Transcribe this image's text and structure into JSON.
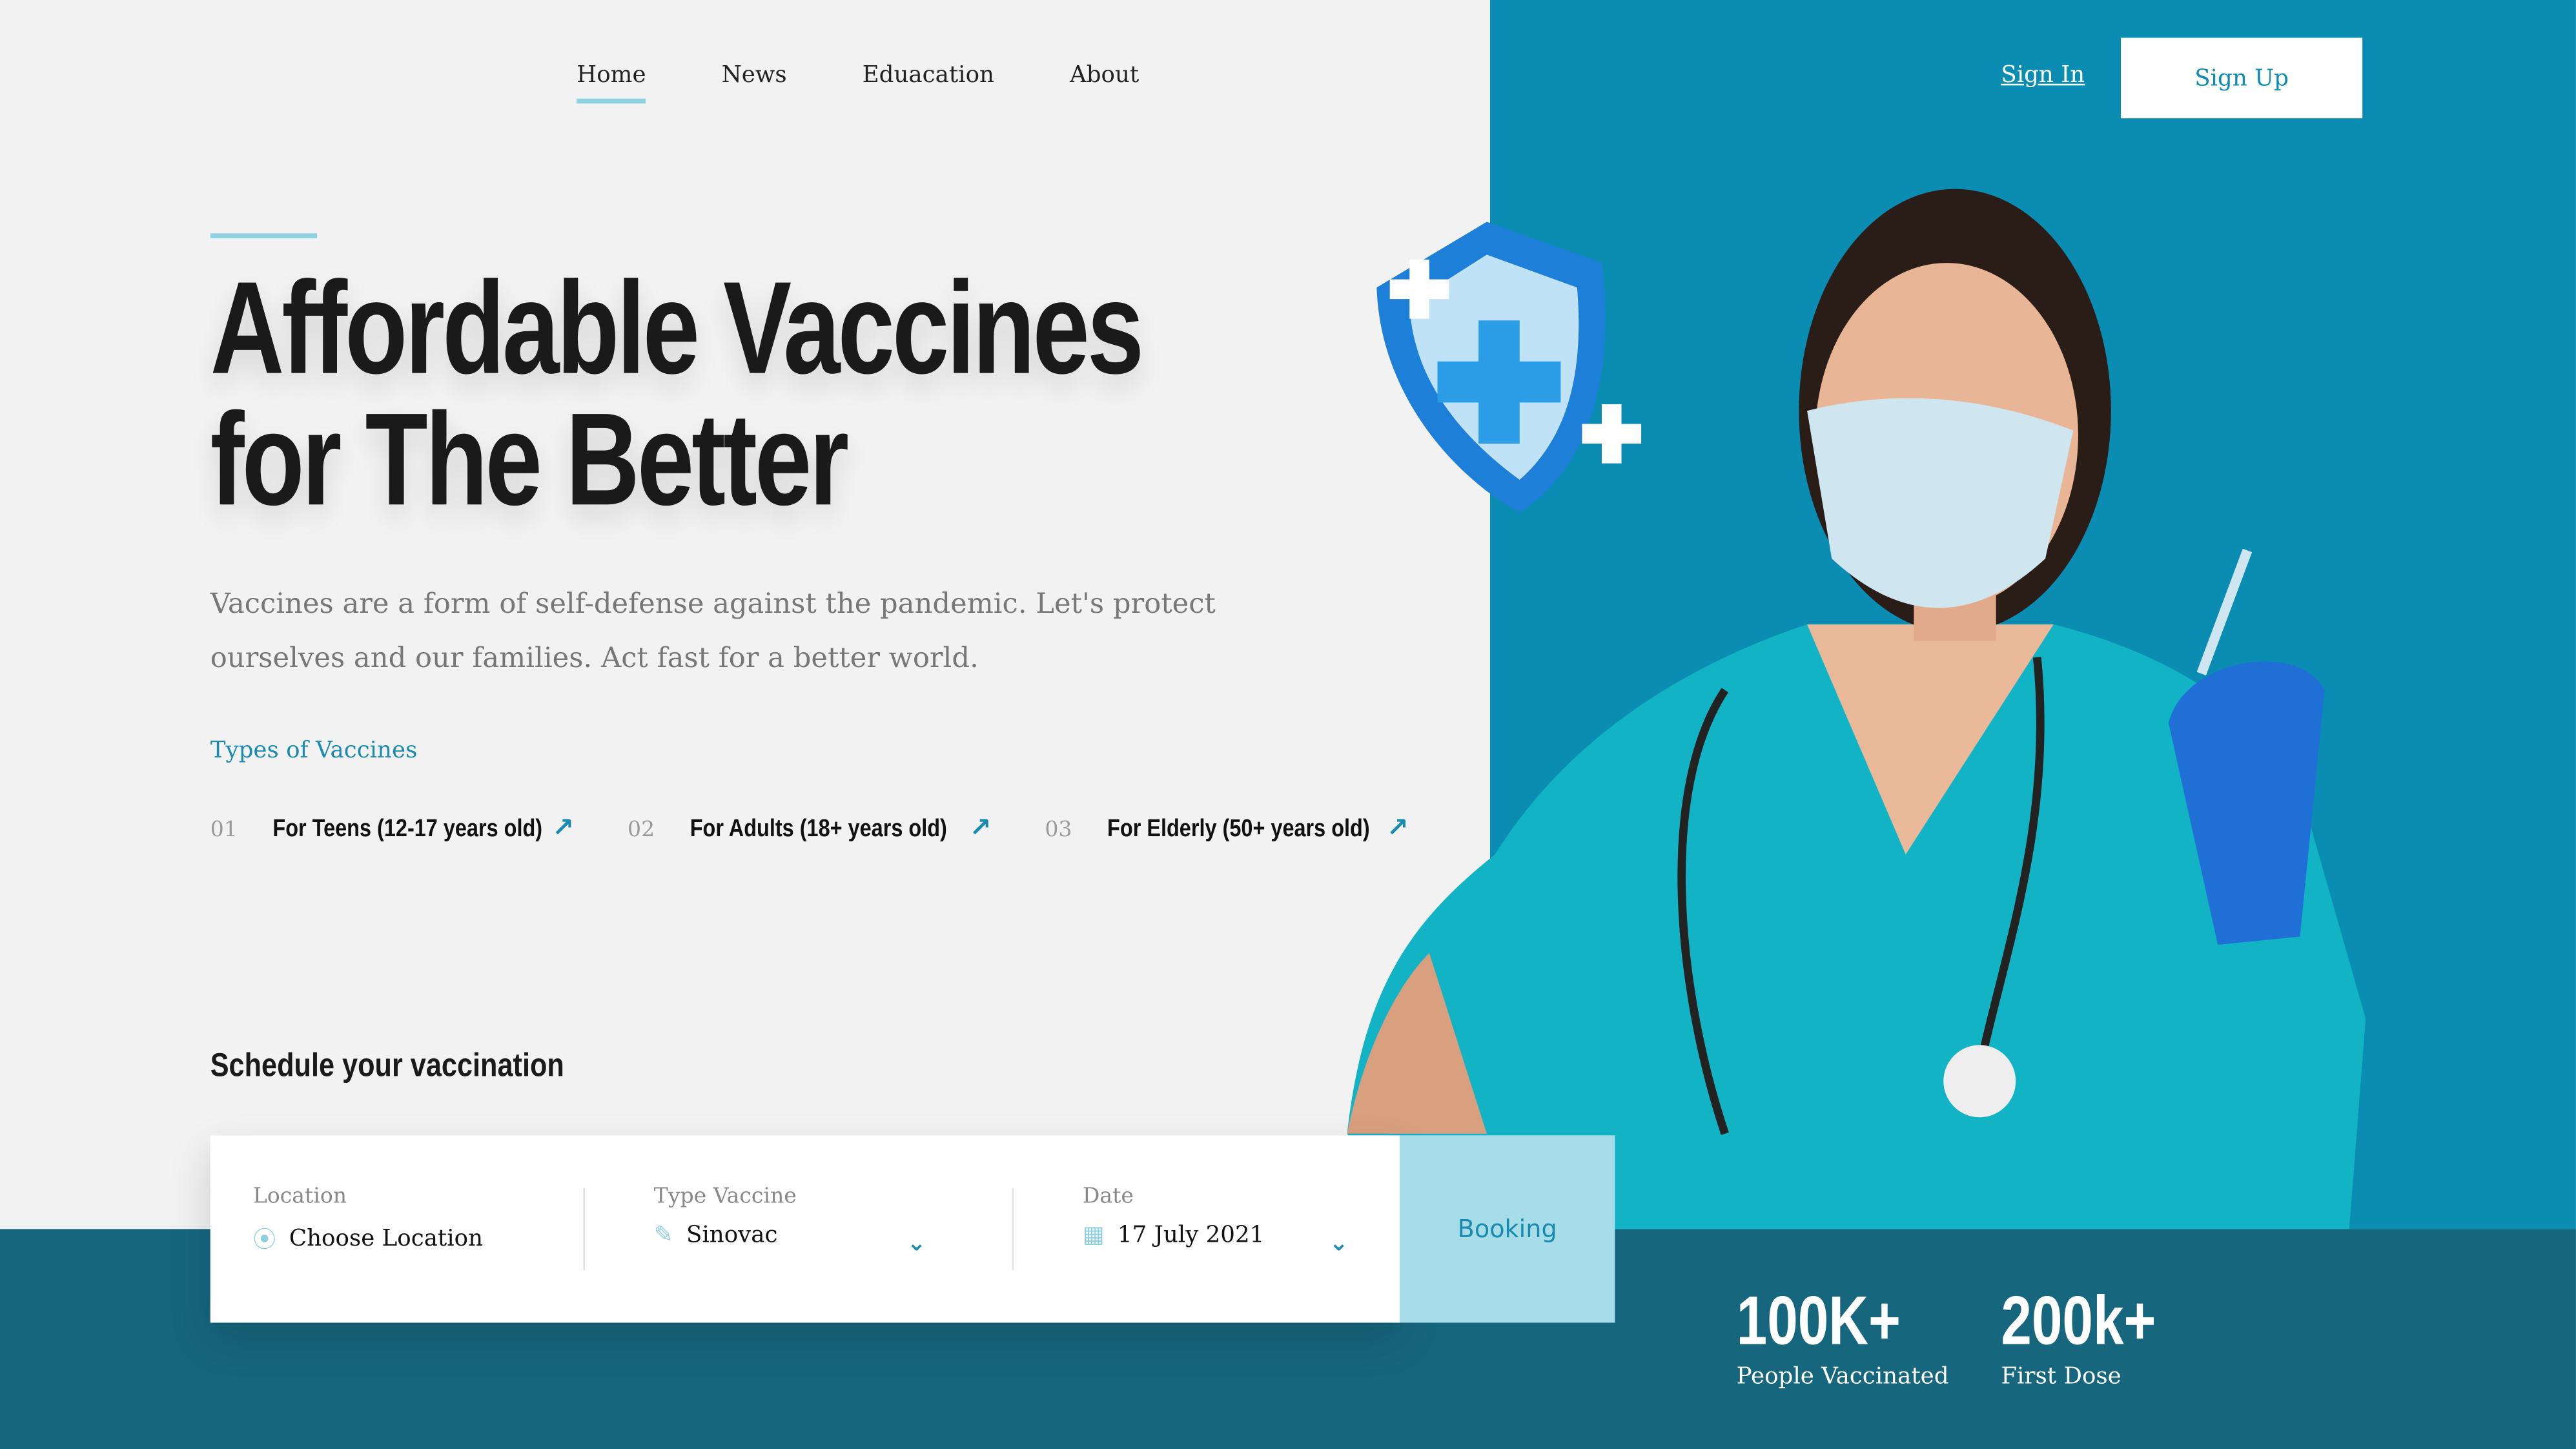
{
  "nav": {
    "items": [
      {
        "label": "Home",
        "active": true
      },
      {
        "label": "News"
      },
      {
        "label": "Eduacation"
      },
      {
        "label": "About"
      }
    ],
    "sign_in": "Sign In",
    "sign_up": "Sign Up"
  },
  "hero": {
    "title_line1": "Affordable Vaccines",
    "title_line2": "for The Better",
    "description": "Vaccines are a form of self-defense against the pandemic. Let's protect ourselves and our families. Act fast for a better world."
  },
  "types": {
    "heading": "Types of Vaccines",
    "items": [
      {
        "num": "01",
        "label": "For Teens (12-17 years old)",
        "icon": "arrow-up-right-icon"
      },
      {
        "num": "02",
        "label": "For Adults (18+ years old)",
        "icon": "arrow-up-right-icon"
      },
      {
        "num": "03",
        "label": "For Elderly (50+ years old)",
        "icon": "arrow-up-right-icon"
      }
    ]
  },
  "schedule": {
    "heading": "Schedule your vaccination",
    "location_label": "Location",
    "location_value": "Choose Location",
    "vaccine_label": "Type Vaccine",
    "vaccine_value": "Sinovac",
    "date_label": "Date",
    "date_value": "17 July 2021",
    "booking": "Booking"
  },
  "stats": [
    {
      "value": "100K+",
      "label": "People Vaccinated"
    },
    {
      "value": "200k+",
      "label": "First Dose"
    }
  ],
  "colors": {
    "brand": "#0b8cb3",
    "band": "#16667e",
    "accent": "#8fd0e0",
    "booking_bg": "#a6dde8"
  }
}
